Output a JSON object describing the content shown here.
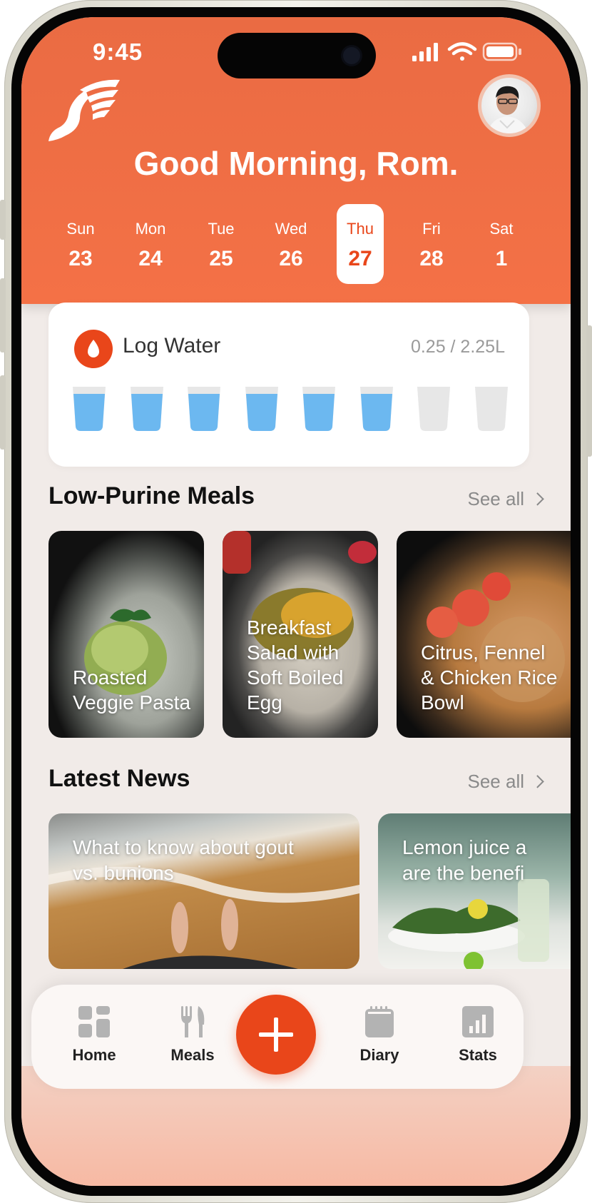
{
  "status_bar": {
    "time": "9:45",
    "icons": [
      "signal-icon",
      "wifi-icon",
      "battery-icon"
    ]
  },
  "header": {
    "greeting": "Good Morning, Rom.",
    "logo": "winged-foot-logo",
    "avatar": "profile-avatar"
  },
  "week": [
    {
      "name": "Sun",
      "num": "23",
      "active": false
    },
    {
      "name": "Mon",
      "num": "24",
      "active": false
    },
    {
      "name": "Tue",
      "num": "25",
      "active": false
    },
    {
      "name": "Wed",
      "num": "26",
      "active": false
    },
    {
      "name": "Thu",
      "num": "27",
      "active": true
    },
    {
      "name": "Fri",
      "num": "28",
      "active": false
    },
    {
      "name": "Sat",
      "num": "1",
      "active": false
    }
  ],
  "water": {
    "title": "Log Water",
    "amount": "0.25 / 2.25L",
    "cups_total": 8,
    "cups_filled": 6
  },
  "meals": {
    "title": "Low-Purine Meals",
    "see_all": "See all",
    "items": [
      {
        "label": "Roasted Veggie Pasta"
      },
      {
        "label": "Breakfast Salad with Soft Boiled Egg"
      },
      {
        "label": "Citrus, Fennel & Chicken Rice Bowl"
      }
    ]
  },
  "news": {
    "title": "Latest News",
    "see_all": "See all",
    "items": [
      {
        "label": "What to know about gout\nvs. bunions"
      },
      {
        "label": "Lemon juice a\nare the benefi"
      }
    ]
  },
  "tabs": {
    "home": "Home",
    "meals": "Meals",
    "diary": "Diary",
    "stats": "Stats"
  },
  "colors": {
    "accent": "#e9461a",
    "header": "#f06d44",
    "water_filled": "#6cb8f0",
    "water_empty": "#e7e7e7",
    "background": "#f1ebe8"
  }
}
